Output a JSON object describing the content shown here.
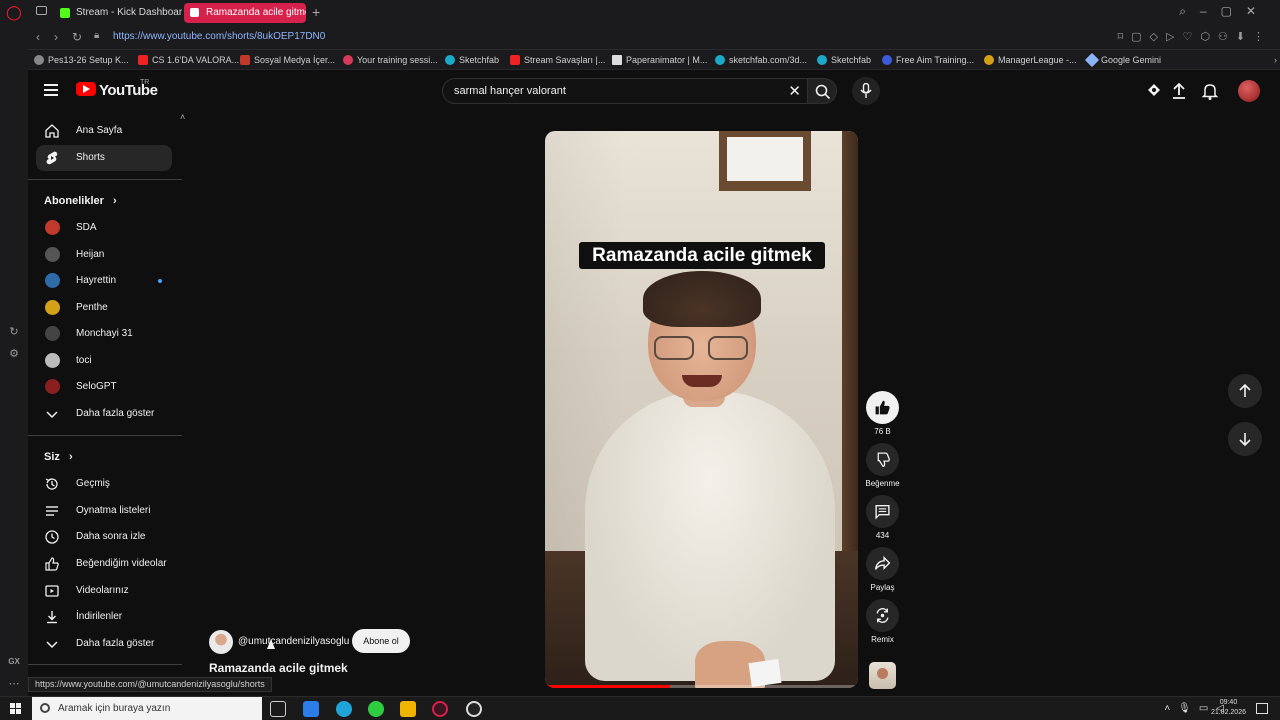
{
  "browser": {
    "tabs": [
      {
        "label": "Stream - Kick Dashboard"
      },
      {
        "label": "Ramazanda acile gitme"
      }
    ],
    "url": "https://www.youtube.com/shorts/8ukOEP17DN0",
    "status_url": "https://www.youtube.com/@umutcandenizilyasoglu/shorts",
    "bookmarks": [
      "Pes13-26 Setup K...",
      "CS 1.6'DA VALORA...",
      "Sosyal Medya İçer...",
      "Your training sessi...",
      "Sketchfab",
      "Stream Savaşları |...",
      "Paperanimator | M...",
      "sketchfab.com/3d...",
      "Sketchfab",
      "Free Aim Training...",
      "ManagerLeague -...",
      "Google Gemini"
    ],
    "rail_label": "GX"
  },
  "youtube": {
    "logo_text": "YouTube",
    "region": "TR",
    "search_value": "sarmal hançer valorant",
    "sidebar": {
      "main": [
        {
          "label": "Ana Sayfa",
          "icon": "home-icon"
        },
        {
          "label": "Shorts",
          "icon": "shorts-icon",
          "active": true
        }
      ],
      "subscriptions_heading": "Abonelikler",
      "subscriptions": [
        {
          "label": "SDA",
          "color": "#c0392b"
        },
        {
          "label": "Heijan",
          "color": "#555555"
        },
        {
          "label": "Hayrettin",
          "color": "#2d6ca8",
          "live": true
        },
        {
          "label": "Penthe",
          "color": "#d4a017"
        },
        {
          "label": "Monchayi 31",
          "color": "#444444"
        },
        {
          "label": "toci",
          "color": "#bbbbbb"
        },
        {
          "label": "SeloGPT",
          "color": "#8b1e1e"
        }
      ],
      "show_more": "Daha fazla göster",
      "you_heading": "Siz",
      "you_items": [
        {
          "label": "Geçmiş",
          "icon": "history-icon"
        },
        {
          "label": "Oynatma listeleri",
          "icon": "playlist-icon"
        },
        {
          "label": "Daha sonra izle",
          "icon": "clock-icon"
        },
        {
          "label": "Beğendiğim videolar",
          "icon": "like-icon"
        },
        {
          "label": "Videolarınız",
          "icon": "video-icon"
        },
        {
          "label": "İndirilenler",
          "icon": "download-icon"
        }
      ],
      "you_show_more": "Daha fazla göster"
    },
    "short": {
      "caption": "Ramazanda acile gitmek",
      "title": "Ramazanda acile gitmek",
      "channel_handle": "@umutcandenizilyasoglu",
      "subscribe_label": "Abone ol",
      "progress": 0.4,
      "actions": {
        "like_count": "76 B",
        "dislike_label": "Beğenme",
        "comment_count": "434",
        "share_label": "Paylaş",
        "remix_label": "Remix"
      }
    }
  },
  "taskbar": {
    "search_placeholder": "Aramak için buraya yazın",
    "time": "09:40",
    "date": "21.02.2026"
  },
  "colors": {
    "yt_red": "#ff0000",
    "opera_tab": "#d6214b",
    "background": "#0f0f0f"
  }
}
